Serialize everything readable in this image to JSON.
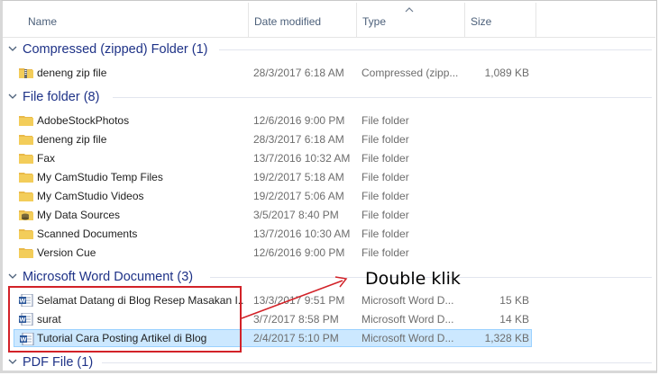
{
  "columns": {
    "name": "Name",
    "date": "Date modified",
    "type": "Type",
    "size": "Size"
  },
  "groups": [
    {
      "title": "Compressed (zipped) Folder (1)",
      "items": [
        {
          "name": "deneng zip file",
          "date": "28/3/2017 6:18 AM",
          "type": "Compressed (zipp...",
          "size": "1,089 KB",
          "icon": "zip-folder-icon"
        }
      ]
    },
    {
      "title": "File folder (8)",
      "items": [
        {
          "name": "AdobeStockPhotos",
          "date": "12/6/2016 9:00 PM",
          "type": "File folder",
          "size": "",
          "icon": "folder-icon"
        },
        {
          "name": "deneng zip file",
          "date": "28/3/2017 6:18 AM",
          "type": "File folder",
          "size": "",
          "icon": "folder-icon"
        },
        {
          "name": "Fax",
          "date": "13/7/2016 10:32 AM",
          "type": "File folder",
          "size": "",
          "icon": "folder-icon"
        },
        {
          "name": "My CamStudio Temp Files",
          "date": "19/2/2017 5:18 AM",
          "type": "File folder",
          "size": "",
          "icon": "folder-icon"
        },
        {
          "name": "My CamStudio Videos",
          "date": "19/2/2017 5:06 AM",
          "type": "File folder",
          "size": "",
          "icon": "folder-icon"
        },
        {
          "name": "My Data Sources",
          "date": "3/5/2017 8:40 PM",
          "type": "File folder",
          "size": "",
          "icon": "data-sources-folder-icon"
        },
        {
          "name": "Scanned Documents",
          "date": "13/7/2016 10:30 AM",
          "type": "File folder",
          "size": "",
          "icon": "folder-icon"
        },
        {
          "name": "Version Cue",
          "date": "12/6/2016 9:00 PM",
          "type": "File folder",
          "size": "",
          "icon": "folder-icon"
        }
      ]
    },
    {
      "title": "Microsoft Word Document (3)",
      "items": [
        {
          "name": "Selamat Datang di Blog Resep Masakan I...",
          "date": "13/3/2017 9:51 PM",
          "type": "Microsoft Word D...",
          "size": "15 KB",
          "icon": "word-document-icon"
        },
        {
          "name": "surat",
          "date": "3/7/2017 8:58 PM",
          "type": "Microsoft Word D...",
          "size": "14 KB",
          "icon": "word-document-icon"
        },
        {
          "name": "Tutorial Cara Posting Artikel di Blog",
          "date": "2/4/2017 5:10 PM",
          "type": "Microsoft Word D...",
          "size": "1,328 KB",
          "icon": "word-document-icon",
          "selected": true
        }
      ]
    },
    {
      "title": "PDF File (1)",
      "items": []
    }
  ],
  "annotation": {
    "text": "Double klik",
    "color": "#d22228"
  },
  "colors": {
    "group_title": "#1e3287",
    "selection_bg": "#cce8ff",
    "selection_border": "#99d1ff",
    "folder": "#f3c94a"
  }
}
